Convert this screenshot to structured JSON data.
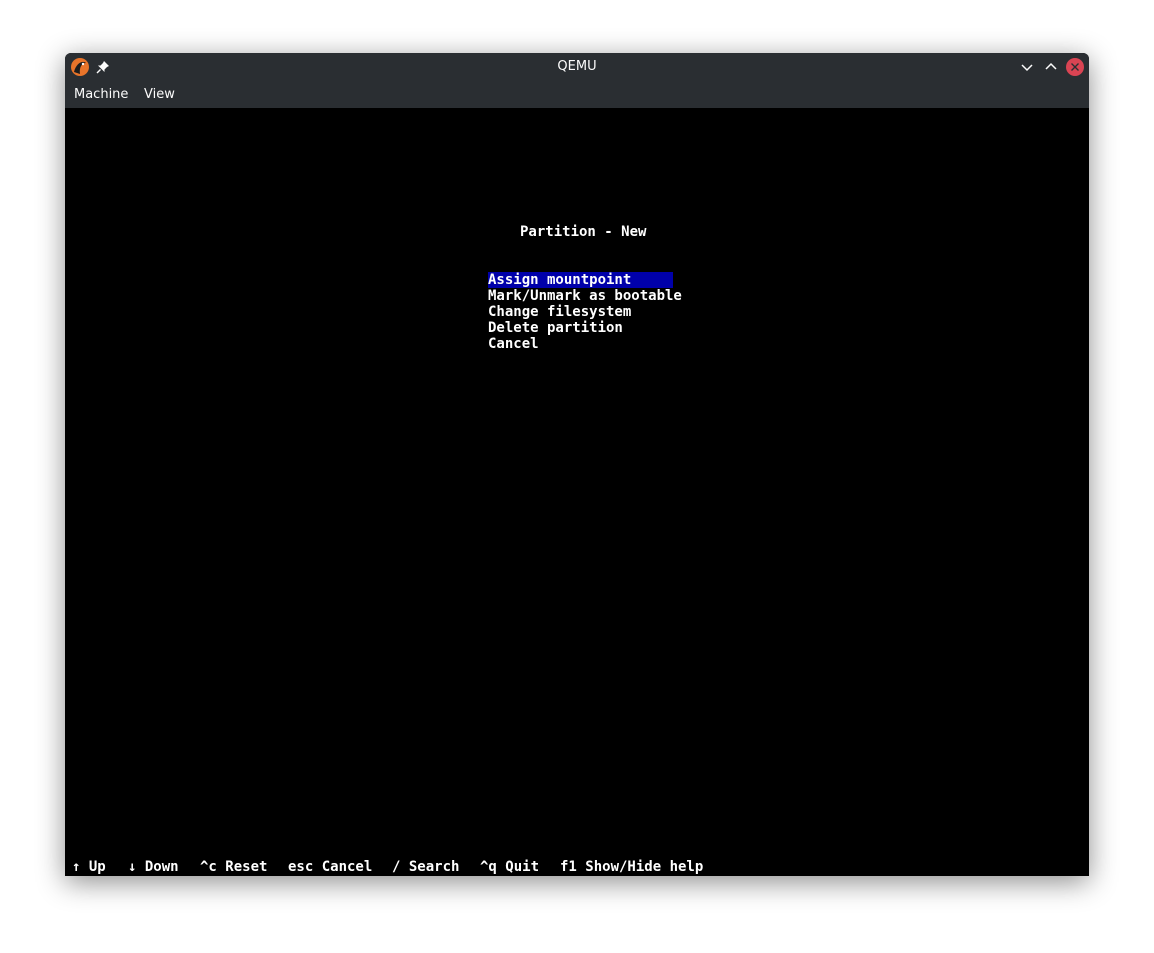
{
  "window": {
    "title": "QEMU"
  },
  "menubar": {
    "items": [
      "Machine",
      "View"
    ]
  },
  "screen": {
    "heading": "Partition - New",
    "options": [
      "Assign mountpoint",
      "Mark/Unmark as bootable",
      "Change filesystem",
      "Delete partition",
      "Cancel"
    ],
    "selected_index": 0
  },
  "footer": {
    "items": [
      "↑ Up",
      "↓ Down",
      "^c Reset",
      "esc Cancel",
      "/ Search",
      "^q Quit",
      "f1 Show/Hide help"
    ]
  },
  "icons": {
    "app": "qemu-logo-icon",
    "pin": "pin-icon",
    "minimize": "chevron-down-icon",
    "maximize": "chevron-up-icon",
    "close": "close-icon"
  },
  "colors": {
    "titlebar": "#2a2e32",
    "close_button": "#da4453",
    "selection": "#0000aa"
  }
}
